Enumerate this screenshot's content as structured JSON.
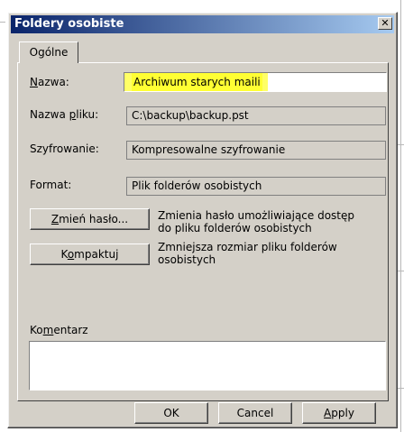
{
  "dialog": {
    "title": "Foldery osobiste",
    "close_icon": "close-icon",
    "tab_label": "Ogólne"
  },
  "fields": {
    "name_label": "Nazwa:",
    "name_value": "Archiwum starych maili",
    "filename_label": "Nazwa pliku:",
    "filename_value": "C:\\backup\\backup.pst",
    "encryption_label": "Szyfrowanie:",
    "encryption_value": "Kompresowalne szyfrowanie",
    "format_label": "Format:",
    "format_value": "Plik folderów osobistych"
  },
  "actions": {
    "change_password_button": "Zmień hasło...",
    "change_password_desc": "Zmienia hasło umożliwiające dostęp do pliku folderów osobistych",
    "compact_button": "Kompaktuj",
    "compact_desc": "Zmniejsza rozmiar pliku folderów osobistych"
  },
  "comment": {
    "label": "Komentarz",
    "value": ""
  },
  "footer": {
    "ok": "OK",
    "cancel": "Cancel",
    "apply": "Apply"
  },
  "colors": {
    "title_start": "#0a246a",
    "title_end": "#a6caf0",
    "dialog_bg": "#d4d0c8",
    "highlight": "#ffff33"
  }
}
